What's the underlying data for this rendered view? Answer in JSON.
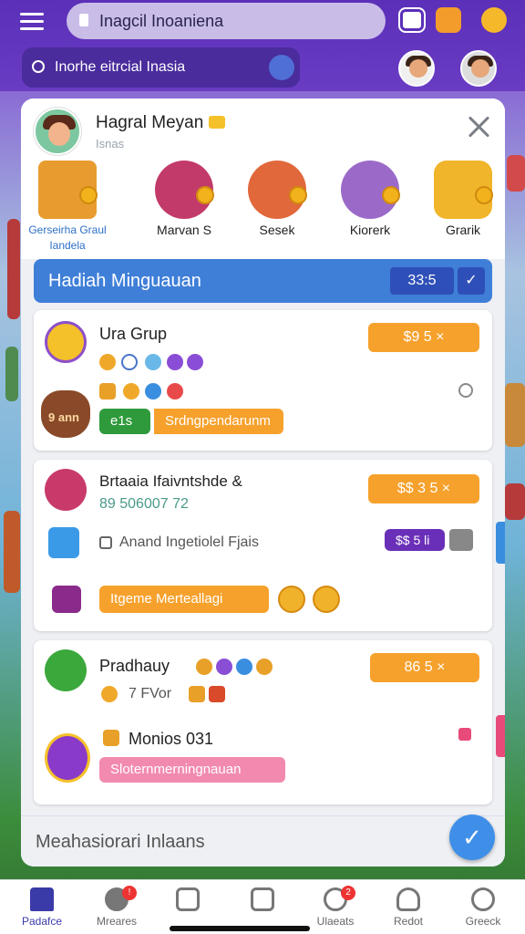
{
  "browser": {
    "url": "Inagcil Inoaniena"
  },
  "search": {
    "placeholder": "Inorhe eitrcial Inasia"
  },
  "profile": {
    "name": "Hagral Meyan",
    "subtitle": "Isnas"
  },
  "gifts": [
    {
      "label": "Gerseirha Graul\nIandela"
    },
    {
      "label": "Marvan S"
    },
    {
      "label": "Sesek"
    },
    {
      "label": "Kiorerk"
    },
    {
      "label": "Grarik"
    }
  ],
  "weekly": {
    "title": "Hadiah Minguauan",
    "badge": "33:5",
    "check": "✓"
  },
  "cards": [
    {
      "title": "Ura Grup",
      "button": "$9 5 ×",
      "chip_green": "e1s",
      "chip_orange": "Srdngpendarunm",
      "coin_label": "9 ann"
    },
    {
      "title": "Brtaaia Ifaivntshde &",
      "sub": "89 506007 72",
      "button": "$$ 3 5 ×",
      "row_label": "Anand  Ingetiolel Fjais",
      "purple_badge": "$$ 5 li",
      "chip_orange": "Itgeme Merteallagi"
    },
    {
      "title": "Pradhauy",
      "sub": "7 FVor",
      "button": "86 5 ×",
      "row_label": "Monios 031",
      "chip_pink": "Sloternmerningnauan"
    }
  ],
  "footer": {
    "text": "Meahasiorari Inlaans",
    "fab": "✓"
  },
  "nav": [
    {
      "label": "Padafce"
    },
    {
      "label": "Mreares",
      "badge": "!"
    },
    {
      "label": ""
    },
    {
      "label": ""
    },
    {
      "label": "Ulaeats",
      "badge": "2"
    },
    {
      "label": "Redot"
    },
    {
      "label": "Greeck"
    }
  ],
  "colors": {
    "accent": "#3f7fd8",
    "orange": "#f6a12c",
    "purple": "#5b2fb8"
  }
}
